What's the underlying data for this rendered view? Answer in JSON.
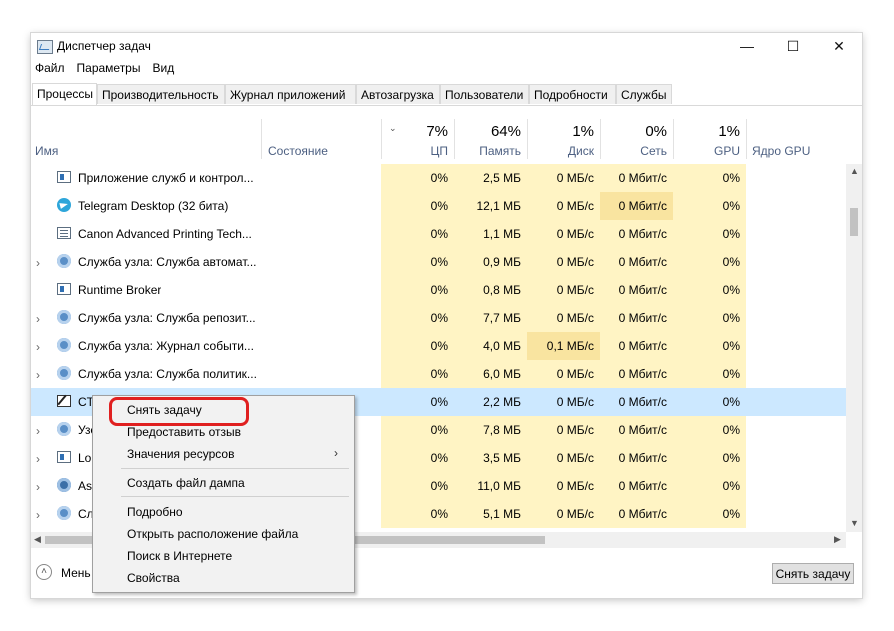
{
  "window": {
    "title": "Диспетчер задач"
  },
  "menubar": {
    "file": "Файл",
    "options": "Параметры",
    "view": "Вид"
  },
  "tabs": [
    "Процессы",
    "Производительность",
    "Журнал приложений",
    "Автозагрузка",
    "Пользователи",
    "Подробности",
    "Службы"
  ],
  "columns": {
    "name": "Имя",
    "status": "Состояние",
    "cpu_pct": "7%",
    "cpu": "ЦП",
    "mem_pct": "64%",
    "mem": "Память",
    "disk_pct": "1%",
    "disk": "Диск",
    "net_pct": "0%",
    "net": "Сеть",
    "gpu_pct": "1%",
    "gpu": "GPU",
    "gpu_engine": "Ядро GPU"
  },
  "rows": [
    {
      "name": "Приложение служб и контрол...",
      "icon": "window-icon",
      "expandable": false,
      "cpu": "0%",
      "mem": "2,5 МБ",
      "disk": "0 МБ/с",
      "net": "0 Мбит/с",
      "gpu": "0%"
    },
    {
      "name": "Telegram Desktop (32 бита)",
      "icon": "telegram-icon",
      "expandable": false,
      "cpu": "0%",
      "mem": "12,1 МБ",
      "disk": "0 МБ/с",
      "net": "0 Мбит/с",
      "gpu": "0%"
    },
    {
      "name": "Canon Advanced Printing Tech...",
      "icon": "printer-app-icon",
      "expandable": false,
      "cpu": "0%",
      "mem": "1,1 МБ",
      "disk": "0 МБ/с",
      "net": "0 Мбит/с",
      "gpu": "0%"
    },
    {
      "name": "Служба узла: Служба автомат...",
      "icon": "gear-icon",
      "expandable": true,
      "cpu": "0%",
      "mem": "0,9 МБ",
      "disk": "0 МБ/с",
      "net": "0 Мбит/с",
      "gpu": "0%"
    },
    {
      "name": "Runtime Broker",
      "icon": "window-icon",
      "expandable": false,
      "cpu": "0%",
      "mem": "0,8 МБ",
      "disk": "0 МБ/с",
      "net": "0 Мбит/с",
      "gpu": "0%"
    },
    {
      "name": "Служба узла: Служба репозит...",
      "icon": "gear-icon",
      "expandable": true,
      "cpu": "0%",
      "mem": "7,7 МБ",
      "disk": "0 МБ/с",
      "net": "0 Мбит/с",
      "gpu": "0%"
    },
    {
      "name": "Служба узла: Журнал событи...",
      "icon": "gear-icon",
      "expandable": true,
      "cpu": "0%",
      "mem": "4,0 МБ",
      "disk": "0,1 МБ/с",
      "net": "0 Мбит/с",
      "gpu": "0%"
    },
    {
      "name": "Служба узла: Служба политик...",
      "icon": "gear-icon",
      "expandable": true,
      "cpu": "0%",
      "mem": "6,0 МБ",
      "disk": "0 МБ/с",
      "net": "0 Мбит/с",
      "gpu": "0%"
    },
    {
      "name": "CT",
      "icon": "notepad-icon",
      "expandable": false,
      "selected": true,
      "cpu": "0%",
      "mem": "2,2 МБ",
      "disk": "0 МБ/с",
      "net": "0 Мбит/с",
      "gpu": "0%"
    },
    {
      "name": "Узе",
      "icon": "gear-icon",
      "expandable": true,
      "cpu": "0%",
      "mem": "7,8 МБ",
      "disk": "0 МБ/с",
      "net": "0 Мбит/с",
      "gpu": "0%"
    },
    {
      "name": "Lo",
      "icon": "window-icon",
      "expandable": true,
      "cpu": "0%",
      "mem": "3,5 МБ",
      "disk": "0 МБ/с",
      "net": "0 Мбит/с",
      "gpu": "0%"
    },
    {
      "name": "As",
      "icon": "app-icon",
      "expandable": true,
      "cpu": "0%",
      "mem": "11,0 МБ",
      "disk": "0 МБ/с",
      "net": "0 Мбит/с",
      "gpu": "0%"
    },
    {
      "name": "Сл",
      "icon": "gear-icon",
      "expandable": true,
      "cpu": "0%",
      "mem": "5,1 МБ",
      "disk": "0 МБ/с",
      "net": "0 Мбит/с",
      "gpu": "0%"
    }
  ],
  "context_menu": {
    "end_task": "Снять задачу",
    "feedback": "Предоставить отзыв",
    "resource_values": "Значения ресурсов",
    "create_dump": "Создать файл дампа",
    "details": "Подробно",
    "open_location": "Открыть расположение файла",
    "search_online": "Поиск в Интернете",
    "properties": "Свойства"
  },
  "footer": {
    "less_details": "Мень",
    "end_task_button": "Снять задачу"
  },
  "colors": {
    "heat": "#fff4c4",
    "heat_high": "#f9e4a0",
    "selection": "#cce8ff",
    "annotation": "#e02020"
  }
}
